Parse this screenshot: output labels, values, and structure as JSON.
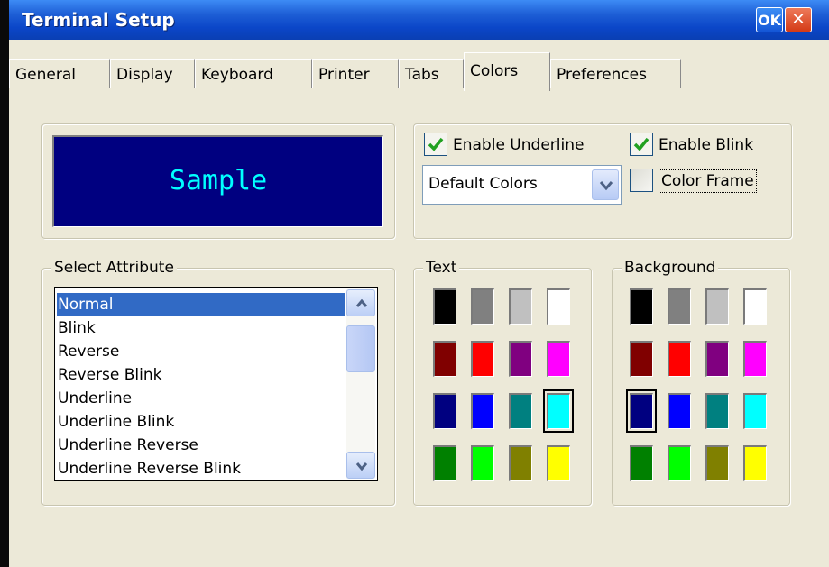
{
  "window": {
    "title": "Terminal Setup",
    "ok_label": "OK",
    "close_label": "✕"
  },
  "tabs": [
    {
      "label": "General"
    },
    {
      "label": "Display"
    },
    {
      "label": "Keyboard"
    },
    {
      "label": "Printer"
    },
    {
      "label": "Tabs"
    },
    {
      "label": "Colors",
      "active": true
    },
    {
      "label": "Preferences"
    }
  ],
  "sample": {
    "text": "Sample",
    "text_color": "#00ffff",
    "bg_color": "#000080"
  },
  "options": {
    "enable_underline": {
      "label": "Enable Underline",
      "checked": true
    },
    "enable_blink": {
      "label": "Enable Blink",
      "checked": true
    },
    "color_frame": {
      "label": "Color Frame",
      "checked": false
    },
    "color_scheme": {
      "value": "Default Colors"
    }
  },
  "select_attribute": {
    "label": "Select Attribute",
    "items": [
      {
        "label": "Normal",
        "selected": true
      },
      {
        "label": "Blink"
      },
      {
        "label": "Reverse"
      },
      {
        "label": "Reverse Blink"
      },
      {
        "label": "Underline"
      },
      {
        "label": "Underline Blink"
      },
      {
        "label": "Underline Reverse"
      },
      {
        "label": "Underline Reverse Blink"
      }
    ]
  },
  "text_colors": {
    "label": "Text",
    "palette": [
      "#000000",
      "#808080",
      "#c0c0c0",
      "#ffffff",
      "#800000",
      "#ff0000",
      "#800080",
      "#ff00ff",
      "#000080",
      "#0000ff",
      "#008080",
      "#00ffff",
      "#008000",
      "#00ff00",
      "#808000",
      "#ffff00"
    ],
    "selected_index": 11
  },
  "background_colors": {
    "label": "Background",
    "palette": [
      "#000000",
      "#808080",
      "#c0c0c0",
      "#ffffff",
      "#800000",
      "#ff0000",
      "#800080",
      "#ff00ff",
      "#000080",
      "#0000ff",
      "#008080",
      "#00ffff",
      "#008000",
      "#00ff00",
      "#808000",
      "#ffff00"
    ],
    "selected_index": 8
  }
}
